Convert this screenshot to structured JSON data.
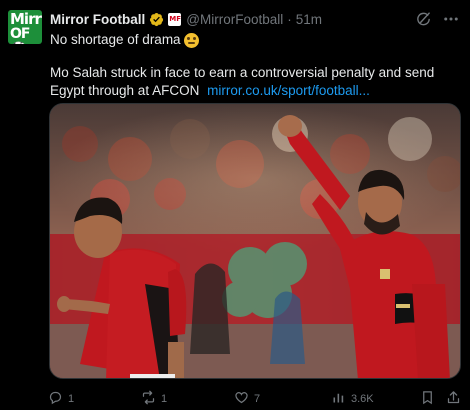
{
  "account": {
    "name": "Mirror Football",
    "handle": "@MirrorFootball",
    "time": "51m",
    "avatar_line1": "Mirr",
    "avatar_line2": "OF⚽",
    "affiliate_badge": "MF"
  },
  "tweet": {
    "line1": "No shortage of drama",
    "body": "Mo Salah struck in face to earn a controversial penalty and send Egypt through at AFCON",
    "link": "mirror.co.uk/sport/football..."
  },
  "actions": {
    "replies": "1",
    "retweets": "1",
    "likes": "7",
    "views": "3.6K"
  },
  "colors": {
    "accent": "#1d9bf0",
    "muted": "#71767b",
    "verified_gold": "#e2b719",
    "kit_red": "#c0181f"
  },
  "icons": [
    "grok-icon",
    "more-icon",
    "reply-icon",
    "retweet-icon",
    "like-icon",
    "views-icon",
    "bookmark-icon",
    "share-icon",
    "verified-badge-icon",
    "grimace-emoji"
  ]
}
